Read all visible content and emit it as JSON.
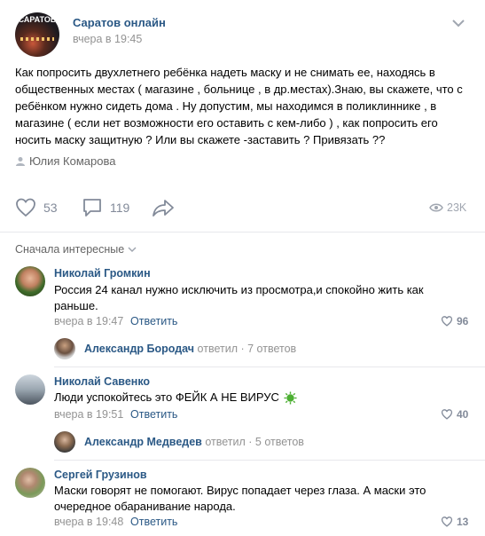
{
  "post": {
    "group_name": "Саратов онлайн",
    "avatar_text": "САРАТОВ",
    "time": "вчера в 19:45",
    "text": "Как попросить двухлетнего ребёнка надеть маску и не снимать ее, находясь в общественных местах ( магазине , больнице , в др.местах).Знаю, вы скажете, что с ребёнком нужно сидеть дома . Ну допустим, мы находимся в поликлиннике , в магазине ( если нет возможности его оставить с кем-либо ) , как попросить его носить маску защитную ? Или вы скажете -заставить ? Привязать ??",
    "author": "Юлия Комарова",
    "likes": "53",
    "comments": "119",
    "views": "23K"
  },
  "sort_label": "Сначала интересные",
  "comments": [
    {
      "name": "Николай Громкин",
      "text": "Россия 24 канал нужно исключить из просмотра,и спокойно жить как раньше.",
      "time": "вчера в 19:47",
      "reply": "Ответить",
      "likes": "96",
      "thread": {
        "name": "Александр Бородач",
        "replied": "ответил",
        "count": "· 7 ответов"
      }
    },
    {
      "name": "Николай Савенко",
      "text": "Люди успокойтесь это ФЕЙК А НЕ ВИРУС",
      "time": "вчера в 19:51",
      "reply": "Ответить",
      "likes": "40",
      "thread": {
        "name": "Александр Медведев",
        "replied": "ответил",
        "count": "· 5 ответов"
      }
    },
    {
      "name": "Сергей Грузинов",
      "text": "Маски говорят не помогают. Вирус попадает через глаза. А маски это очередное обаранивание народа.",
      "time": "вчера в 19:48",
      "reply": "Ответить",
      "likes": "13"
    }
  ],
  "colors": {
    "link": "#2a5885",
    "gray": "#939393",
    "icon": "#828a99",
    "separator": "#e7e8ec"
  }
}
